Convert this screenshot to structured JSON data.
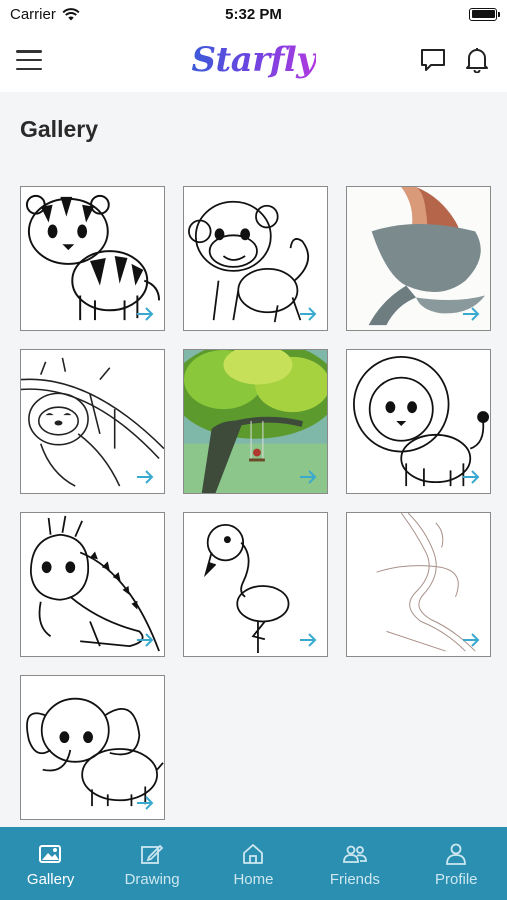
{
  "status_bar": {
    "carrier": "Carrier",
    "time": "5:32 PM"
  },
  "header": {
    "logo_text": "Starfly",
    "menu_icon": "hamburger-menu-icon",
    "actions": [
      {
        "icon": "chat-bubble-icon"
      },
      {
        "icon": "bell-icon"
      }
    ]
  },
  "page": {
    "title": "Gallery"
  },
  "gallery": {
    "items": [
      {
        "subject": "tiger",
        "style": "line-art"
      },
      {
        "subject": "monkey",
        "style": "line-art"
      },
      {
        "subject": "mermaid",
        "style": "color-painting"
      },
      {
        "subject": "sloth",
        "style": "line-art"
      },
      {
        "subject": "tree-swing",
        "style": "color-painting"
      },
      {
        "subject": "lion",
        "style": "line-art"
      },
      {
        "subject": "iguana",
        "style": "line-art"
      },
      {
        "subject": "flamingo",
        "style": "line-art"
      },
      {
        "subject": "mermaid-sketch",
        "style": "pencil-sketch"
      },
      {
        "subject": "elephant",
        "style": "line-art"
      }
    ],
    "open_icon": "arrow-right-icon",
    "open_icon_color": "#39a9cf"
  },
  "tab_bar": {
    "background": "#2a8fb1",
    "tabs": [
      {
        "label": "Gallery",
        "icon": "gallery-image-icon",
        "active": true
      },
      {
        "label": "Drawing",
        "icon": "edit-pencil-icon",
        "active": false
      },
      {
        "label": "Home",
        "icon": "home-icon",
        "active": false
      },
      {
        "label": "Friends",
        "icon": "friends-icon",
        "active": false
      },
      {
        "label": "Profile",
        "icon": "profile-person-icon",
        "active": false
      }
    ]
  }
}
